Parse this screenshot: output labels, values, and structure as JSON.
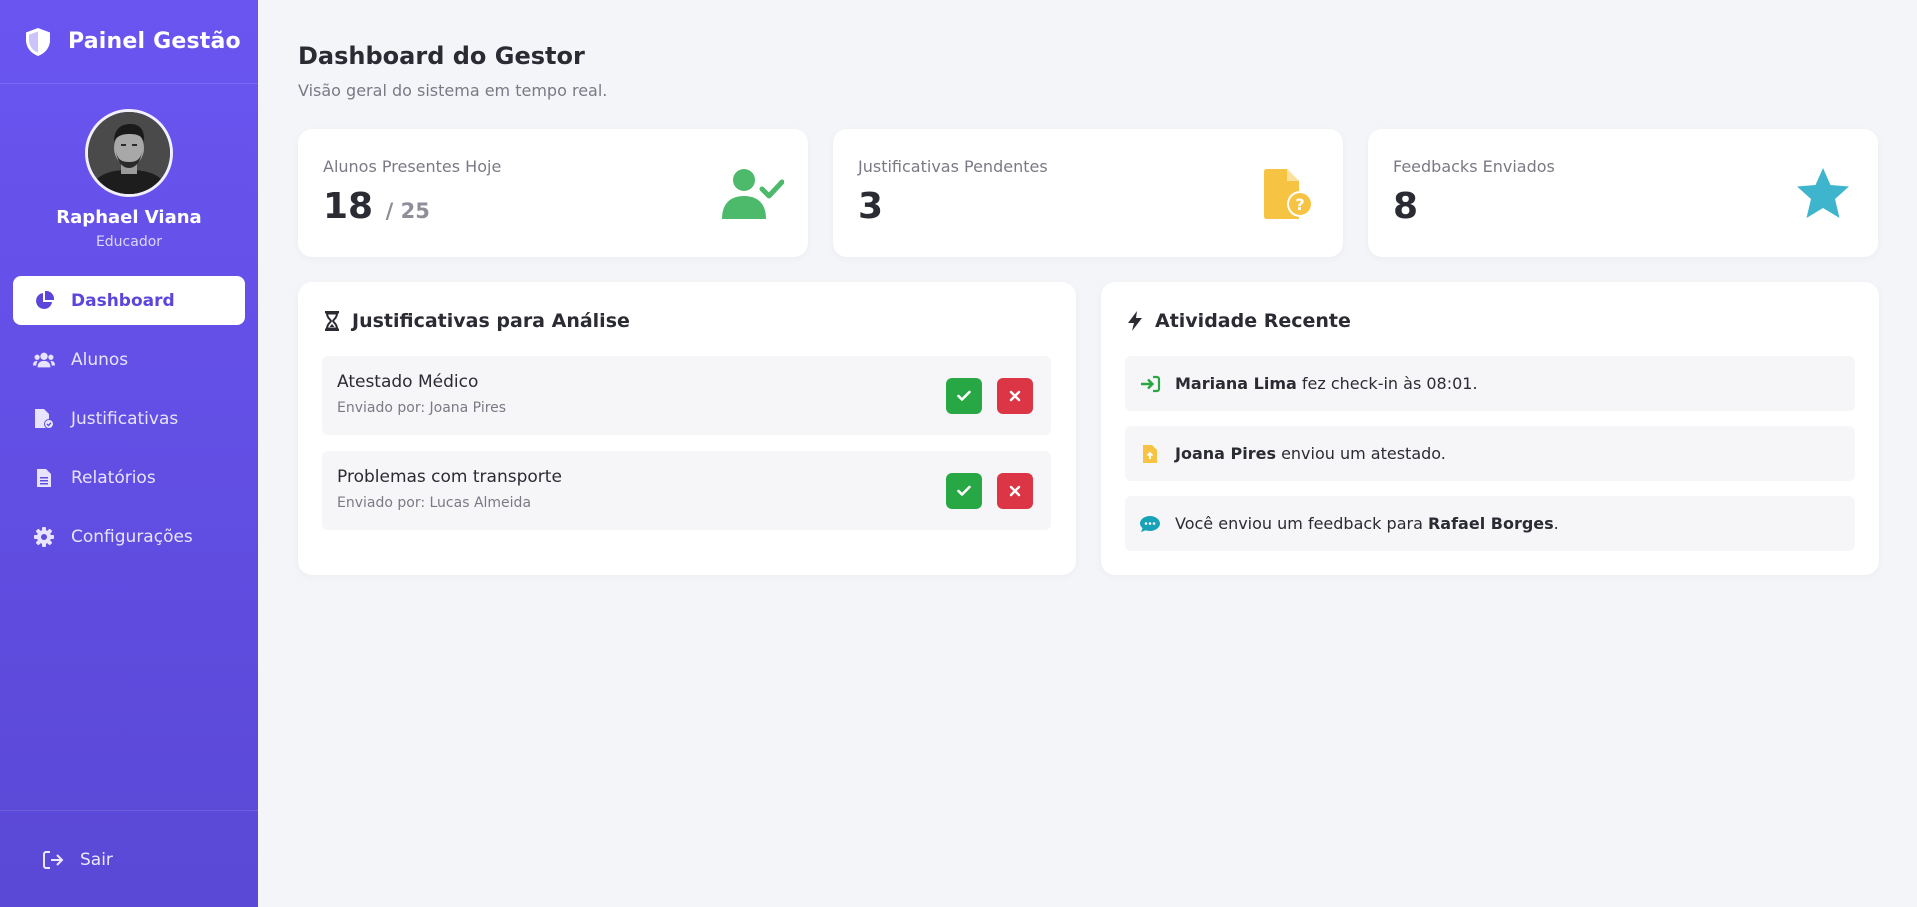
{
  "sidebar": {
    "brand": "Painel Gestão",
    "user": {
      "name": "Raphael Viana",
      "role": "Educador"
    },
    "nav": [
      {
        "label": "Dashboard",
        "icon": "pie-chart-icon",
        "active": true
      },
      {
        "label": "Alunos",
        "icon": "users-icon"
      },
      {
        "label": "Justificativas",
        "icon": "file-check-icon"
      },
      {
        "label": "Relatórios",
        "icon": "document-icon"
      },
      {
        "label": "Configurações",
        "icon": "gear-icon"
      }
    ],
    "logout": "Sair"
  },
  "header": {
    "title": "Dashboard do Gestor",
    "subtitle": "Visão geral do sistema em tempo real."
  },
  "stats": [
    {
      "label": "Alunos Presentes Hoje",
      "value": "18",
      "total": "/ 25",
      "icon": "user-check-icon",
      "color": "#4cb96b"
    },
    {
      "label": "Justificativas Pendentes",
      "value": "3",
      "icon": "file-question-icon",
      "color": "#f6c343"
    },
    {
      "label": "Feedbacks Enviados",
      "value": "8",
      "icon": "star-icon",
      "color": "#3eb5cc"
    }
  ],
  "justifications": {
    "title": "Justificativas para Análise",
    "items": [
      {
        "title": "Atestado Médico",
        "sender": "Enviado por: Joana Pires"
      },
      {
        "title": "Problemas com transporte",
        "sender": "Enviado por: Lucas Almeida"
      }
    ]
  },
  "activity": {
    "title": "Atividade Recente",
    "items": [
      {
        "bold": "Mariana Lima",
        "text": " fez check-in às 08:01.",
        "icon": "sign-in-icon"
      },
      {
        "bold": "Joana Pires",
        "text": " enviou um atestado.",
        "icon": "file-upload-icon"
      },
      {
        "prefix": "Você enviou um feedback para ",
        "bold": "Rafael Borges",
        "suffix": ".",
        "icon": "comment-icon"
      }
    ]
  },
  "colors": {
    "sidebar_top": "#6a55f1",
    "sidebar_bottom": "#5a48d6",
    "approve": "#28a745",
    "reject": "#dc3545"
  }
}
